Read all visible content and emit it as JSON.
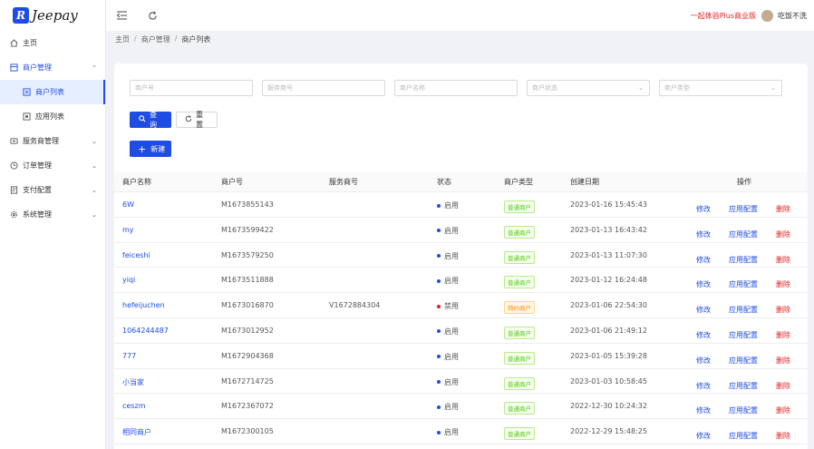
{
  "app": {
    "logo_mark": "R",
    "logo_text": "Jeepay"
  },
  "sidebar": {
    "items": [
      {
        "label": "主页",
        "icon": "home-icon"
      },
      {
        "label": "商户管理",
        "icon": "store-icon",
        "open": true
      },
      {
        "label": "商户列表",
        "icon": "list-icon",
        "sub": true,
        "active": true
      },
      {
        "label": "应用列表",
        "icon": "app-icon",
        "sub": true
      },
      {
        "label": "服务商管理",
        "icon": "service-icon"
      },
      {
        "label": "订单管理",
        "icon": "order-icon"
      },
      {
        "label": "支付配置",
        "icon": "pay-config-icon"
      },
      {
        "label": "系统管理",
        "icon": "system-icon"
      }
    ]
  },
  "header": {
    "promo": "一起体验Plus商业版",
    "user": "吃饭不洗"
  },
  "breadcrumb": {
    "home": "主页",
    "level1": "商户管理",
    "current": "商户列表"
  },
  "filters": {
    "mch_no": "商户号",
    "isv_no": "服务商号",
    "mch_name": "商户名称",
    "state": "商户状态",
    "type": "商户类型"
  },
  "buttons": {
    "search": "查询",
    "reset": "重置",
    "new": "新建"
  },
  "table": {
    "headers": {
      "name": "商户名称",
      "no": "商户号",
      "svc": "服务商号",
      "state": "状态",
      "type": "商户类型",
      "date": "创建日期",
      "op": "操作"
    },
    "ops": {
      "edit": "修改",
      "config": "应用配置",
      "delete": "删除"
    },
    "rows": [
      {
        "name": "6W",
        "no": "M1673855143",
        "svc": "",
        "state": "启用",
        "state_on": true,
        "type": "普通商户",
        "special": false,
        "date": "2023-01-16 15:45:43"
      },
      {
        "name": "my",
        "no": "M1673599422",
        "svc": "",
        "state": "启用",
        "state_on": true,
        "type": "普通商户",
        "special": false,
        "date": "2023-01-13 16:43:42"
      },
      {
        "name": "feiceshi",
        "no": "M1673579250",
        "svc": "",
        "state": "启用",
        "state_on": true,
        "type": "普通商户",
        "special": false,
        "date": "2023-01-13 11:07:30"
      },
      {
        "name": "yiqi",
        "no": "M1673511888",
        "svc": "",
        "state": "启用",
        "state_on": true,
        "type": "普通商户",
        "special": false,
        "date": "2023-01-12 16:24:48"
      },
      {
        "name": "hefeijuchen",
        "no": "M1673016870",
        "svc": "V1672884304",
        "state": "禁用",
        "state_on": false,
        "type": "特约商户",
        "special": true,
        "date": "2023-01-06 22:54:30"
      },
      {
        "name": "1064244487",
        "no": "M1673012952",
        "svc": "",
        "state": "启用",
        "state_on": true,
        "type": "普通商户",
        "special": false,
        "date": "2023-01-06 21:49:12"
      },
      {
        "name": "777",
        "no": "M1672904368",
        "svc": "",
        "state": "启用",
        "state_on": true,
        "type": "普通商户",
        "special": false,
        "date": "2023-01-05 15:39:28"
      },
      {
        "name": "小当家",
        "no": "M1672714725",
        "svc": "",
        "state": "启用",
        "state_on": true,
        "type": "普通商户",
        "special": false,
        "date": "2023-01-03 10:58:45"
      },
      {
        "name": "ceszm",
        "no": "M1672367072",
        "svc": "",
        "state": "启用",
        "state_on": true,
        "type": "普通商户",
        "special": false,
        "date": "2022-12-30 10:24:32"
      },
      {
        "name": "相同商户",
        "no": "M1672300105",
        "svc": "",
        "state": "启用",
        "state_on": true,
        "type": "普通商户",
        "special": false,
        "date": "2022-12-29 15:48:25"
      }
    ]
  },
  "colors": {
    "primary": "#1f4de4",
    "danger": "#e02020",
    "success": "#52c41a",
    "warning": "#fa8c16"
  }
}
